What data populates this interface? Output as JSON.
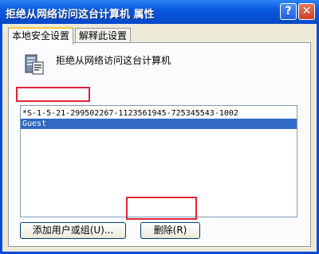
{
  "window": {
    "title": "拒绝从网络访问这台计算机 属性",
    "help_button": "?",
    "close_button": "✕"
  },
  "tabs": [
    {
      "label": "本地安全设置",
      "active": true
    },
    {
      "label": "解释此设置",
      "active": false
    }
  ],
  "policy": {
    "icon": "policy-server-icon",
    "title": "拒绝从网络访问这台计算机"
  },
  "list": {
    "items": [
      {
        "text": "*S-1-5-21-299502267-1123561945-725345543-1002",
        "selected": false
      },
      {
        "text": "Guest",
        "selected": true
      }
    ]
  },
  "buttons": {
    "add": "添加用户或组(U)...",
    "remove": "删除(R)"
  },
  "colors": {
    "titlebar": "#0a5ae0",
    "selection": "#316ac5",
    "highlight": "#e0233a",
    "tab_accent": "#ffc83c"
  }
}
